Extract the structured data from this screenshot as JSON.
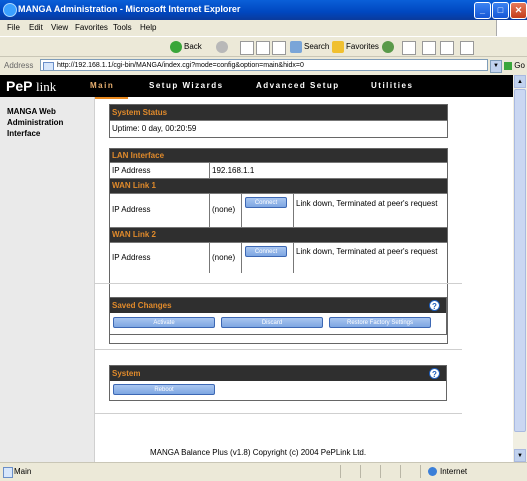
{
  "window": {
    "title": "MANGA Administration - Microsoft Internet Explorer",
    "minimize": "_",
    "maximize": "□",
    "close": "✕"
  },
  "menu": [
    "File",
    "Edit",
    "View",
    "Favorites",
    "Tools",
    "Help"
  ],
  "toolbar": {
    "back": "Back",
    "search": "Search",
    "favorites": "Favorites"
  },
  "address": {
    "label": "Address",
    "url": "http://192.168.1.1/cgi-bin/MANGA/index.cgi?mode=config&option=main&hidx=0",
    "go": "Go"
  },
  "app": {
    "logo_pep": "PeP",
    "logo_link": "link",
    "nav": [
      "Main",
      "Setup Wizards",
      "Advanced Setup",
      "Utilities"
    ],
    "sidebar_title": "MANGA Web Administration Interface"
  },
  "system_status": {
    "title": "System Status",
    "uptime": "Uptime: 0 day, 00:20:59"
  },
  "lan": {
    "title": "LAN Interface",
    "ip_label": "IP Address",
    "ip_value": "192.168.1.1"
  },
  "wan1": {
    "title": "WAN Link 1",
    "ip_label": "IP Address",
    "ip_value": "(none)",
    "button": "Connect",
    "status": "Link down, Terminated at peer's request"
  },
  "wan2": {
    "title": "WAN Link 2",
    "ip_label": "IP Address",
    "ip_value": "(none)",
    "button": "Connect",
    "status": "Link down, Terminated at peer's request"
  },
  "saved_changes": {
    "title": "Saved Changes",
    "help": "?",
    "activate": "Activate",
    "discard": "Discard",
    "restore": "Restore Factory Settings"
  },
  "system": {
    "title": "System",
    "help": "?",
    "reboot": "Reboot"
  },
  "footer": "MANGA Balance Plus (v1.8) Copyright (c) 2004 PePLink Ltd.",
  "status": {
    "left": "Main",
    "zone": "Internet"
  }
}
